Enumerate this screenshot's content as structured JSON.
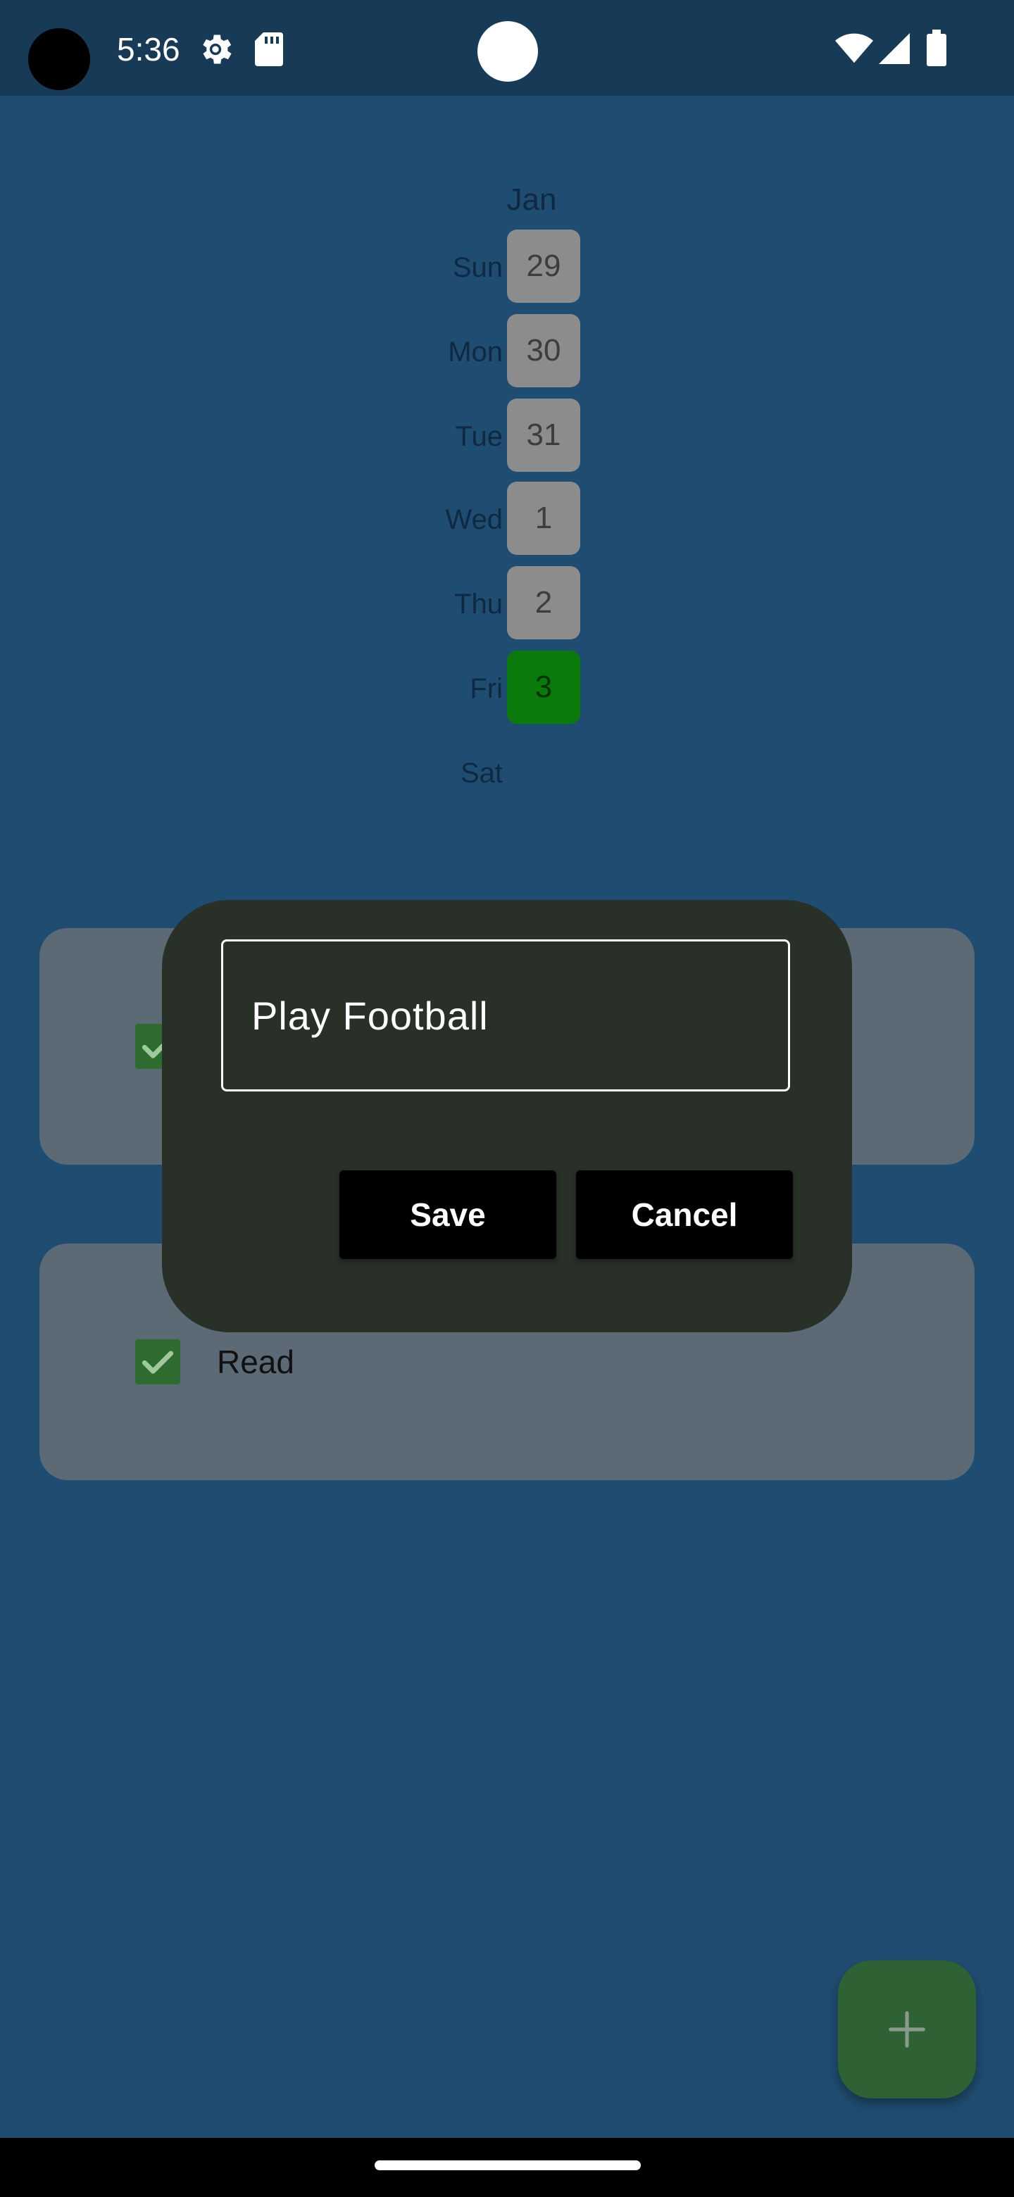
{
  "status_bar": {
    "time": "5:36",
    "icons": [
      "camera-cutout",
      "settings-icon",
      "sd-card-icon",
      "notification-dot",
      "wifi-icon",
      "signal-icon",
      "battery-icon"
    ]
  },
  "calendar": {
    "month": "Jan",
    "days": [
      {
        "weekday": "Sun",
        "date": "29"
      },
      {
        "weekday": "Mon",
        "date": "30"
      },
      {
        "weekday": "Tue",
        "date": "31"
      },
      {
        "weekday": "Wed",
        "date": "1"
      },
      {
        "weekday": "Thu",
        "date": "2"
      },
      {
        "weekday": "Fri",
        "date": "3",
        "selected": true
      },
      {
        "weekday": "Sat",
        "date": ""
      }
    ]
  },
  "tasks": [
    {
      "label": "",
      "checked": true
    },
    {
      "label": "Read",
      "checked": true
    }
  ],
  "dialog": {
    "input_value": "Play Football",
    "save_label": "Save",
    "cancel_label": "Cancel"
  },
  "fab": {
    "icon": "plus-icon"
  },
  "colors": {
    "background": "#1f4d72",
    "status_bar": "#173a57",
    "card": "#5c6a76",
    "dialog": "#283028",
    "today": "#0a7a0a",
    "fab": "#2e6134"
  }
}
